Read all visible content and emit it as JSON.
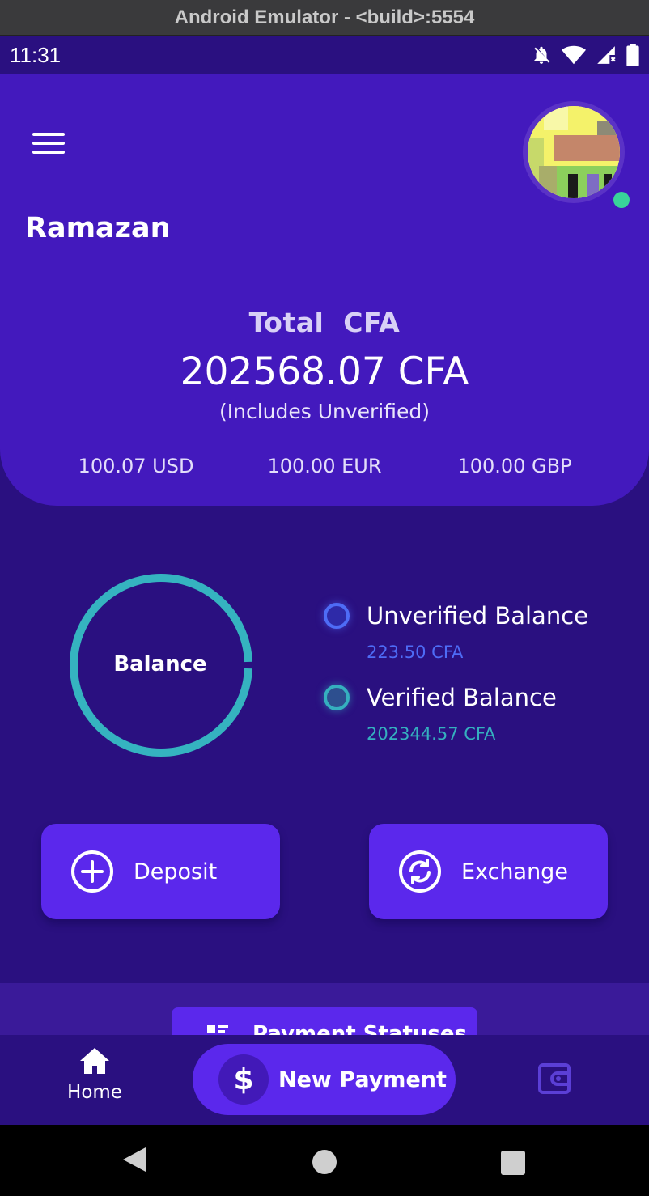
{
  "emulator": {
    "title": "Android Emulator - <build>:5554"
  },
  "status_bar": {
    "time": "11:31"
  },
  "header": {
    "user_name": "Ramazan",
    "total_label": "Total  CFA",
    "total_amount": "202568.07 CFA",
    "total_note": "(Includes Unverified)",
    "currencies": [
      "100.07 USD",
      "100.00 EUR",
      "100.00 GBP"
    ]
  },
  "balance_chart": {
    "center_label": "Balance",
    "segments": [
      {
        "label": "Unverified Balance",
        "value": 223.5,
        "color": "#3f64f0"
      },
      {
        "label": "Verified Balance",
        "value": 202344.57,
        "color": "#35b3c0"
      }
    ]
  },
  "legend": [
    {
      "title": "Unverified Balance",
      "value": "223.50 CFA",
      "color": "#4e6cf6"
    },
    {
      "title": "Verified Balance",
      "value": "202344.57 CFA",
      "color": "#35b0bf"
    }
  ],
  "actions": {
    "deposit_label": "Deposit",
    "exchange_label": "Exchange"
  },
  "payment_statuses": {
    "label": "Payment Statuses"
  },
  "bottom_nav": {
    "home_label": "Home",
    "new_payment_label": "New Payment"
  },
  "colors": {
    "header_bg": "#4319bd",
    "page_bg": "#2a1080",
    "accent": "#5b28ec",
    "online": "#39d39a"
  }
}
